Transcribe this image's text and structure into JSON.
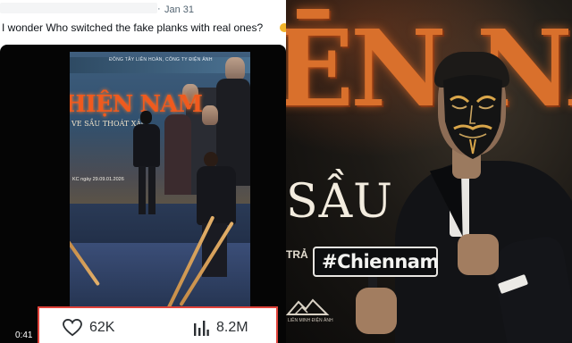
{
  "tweet": {
    "separator": "·",
    "date": "Jan 31",
    "text": "I wonder Who switched the fake planks with real ones?",
    "video": {
      "poster": {
        "studio_line": "ĐÔNG TÂY LIÊN HOÀN, CÔNG TY ĐIỆN ẢNH",
        "title": "HIỆN NAM",
        "subtitle": "VE SẦU THOÁT XÁC",
        "release_line": "KC ngày 29.09.01.2026"
      },
      "stats": {
        "likes": "62K",
        "views": "8.2M",
        "like_icon": "heart-icon",
        "views_icon": "bar-chart-icon",
        "highlight_color": "#e0423a"
      },
      "timestamp": "0:41"
    }
  },
  "photo": {
    "title": "ĒN NA",
    "subtitle": "SẦU",
    "tra_text": "TRẢ",
    "hashtag_sign": "#Chiennam",
    "studio_logo_text": "LIÊN MINH ĐIỆN ẢNH",
    "accent_color": "#d9702c"
  }
}
